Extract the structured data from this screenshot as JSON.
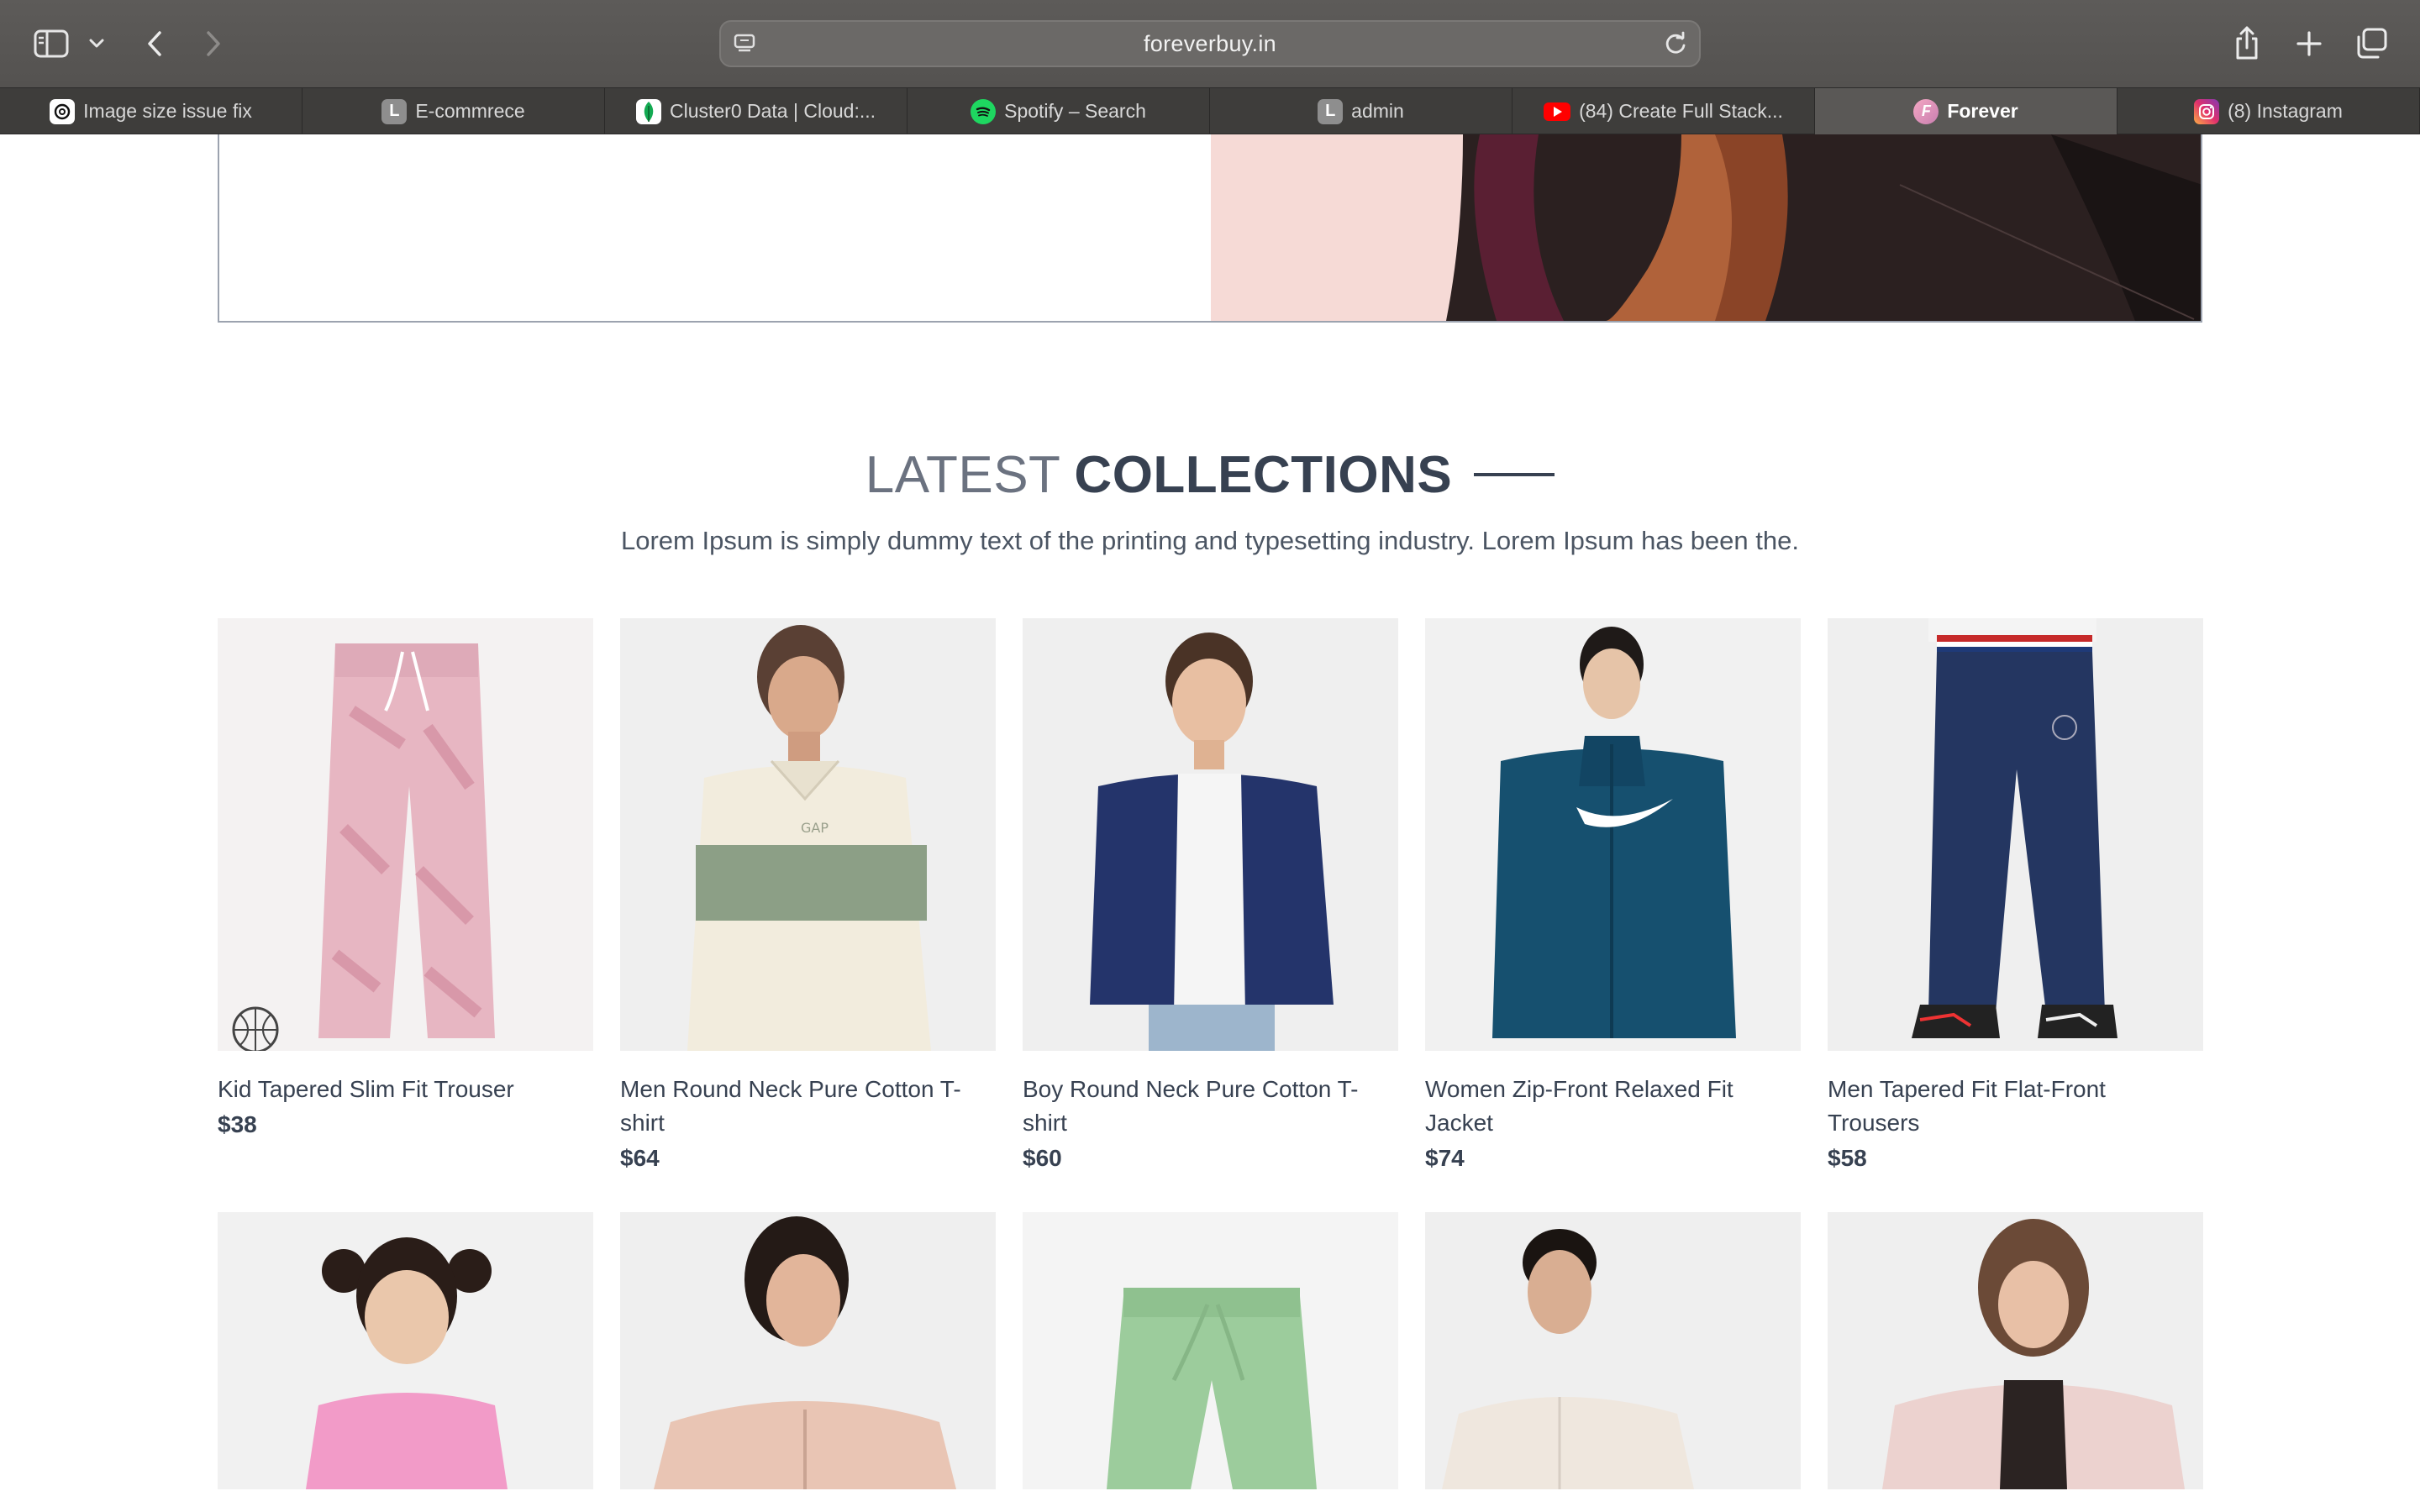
{
  "browser": {
    "url": "foreverbuy.in",
    "tabs": [
      {
        "label": "Image size issue fix",
        "icon": "openai-icon",
        "active": false
      },
      {
        "label": "E-commrece",
        "icon": "letter-l-icon",
        "active": false
      },
      {
        "label": "Cluster0 Data | Cloud:...",
        "icon": "mongodb-leaf-icon",
        "active": false
      },
      {
        "label": "Spotify – Search",
        "icon": "spotify-icon",
        "active": false
      },
      {
        "label": "admin",
        "icon": "letter-l-icon",
        "active": false
      },
      {
        "label": "(84) Create Full Stack...",
        "icon": "youtube-icon",
        "active": false
      },
      {
        "label": "Forever",
        "icon": "forever-f-icon",
        "active": true
      },
      {
        "label": "(8) Instagram",
        "icon": "instagram-icon",
        "active": false
      }
    ]
  },
  "collections": {
    "title_light": "LATEST",
    "title_bold": "COLLECTIONS",
    "description": "Lorem Ipsum is simply dummy text of the printing and typesetting industry. Lorem Ipsum has been the."
  },
  "products": [
    {
      "name": "Kid Tapered Slim Fit Trouser",
      "price": "$38"
    },
    {
      "name": "Men Round Neck Pure Cotton T-shirt",
      "price": "$64"
    },
    {
      "name": "Boy Round Neck Pure Cotton T-shirt",
      "price": "$60"
    },
    {
      "name": "Women Zip-Front Relaxed Fit Jacket",
      "price": "$74"
    },
    {
      "name": "Men Tapered Fit Flat-Front Trousers",
      "price": "$58"
    }
  ],
  "colors": {
    "accent_dark": "#374151",
    "muted_text": "#6b7280",
    "hero_pink": "#f6dad6",
    "active_tab": "#5a5856"
  }
}
